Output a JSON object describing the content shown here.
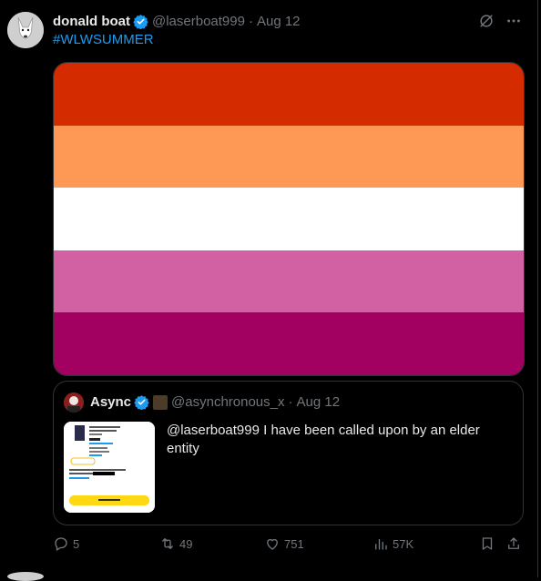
{
  "tweet": {
    "author_name": "donald boat",
    "handle": "@laserboat999",
    "separator": "·",
    "date": "Aug 12",
    "hashtag": "#WLWSUMMER"
  },
  "flag": {
    "stripe_colors": [
      "#d42c00",
      "#fd9855",
      "#ffffff",
      "#d161a2",
      "#a20161"
    ]
  },
  "quote": {
    "author_name": "Async",
    "handle": "@asynchronous_x",
    "separator": "·",
    "date": "Aug 12",
    "text": "@laserboat999 I have been called upon by an elder entity"
  },
  "actions": {
    "replies": "5",
    "reposts": "49",
    "likes": "751",
    "views": "57K"
  },
  "colors": {
    "accent": "#1d9bf0",
    "muted": "#71767b",
    "border": "#2f3336"
  }
}
